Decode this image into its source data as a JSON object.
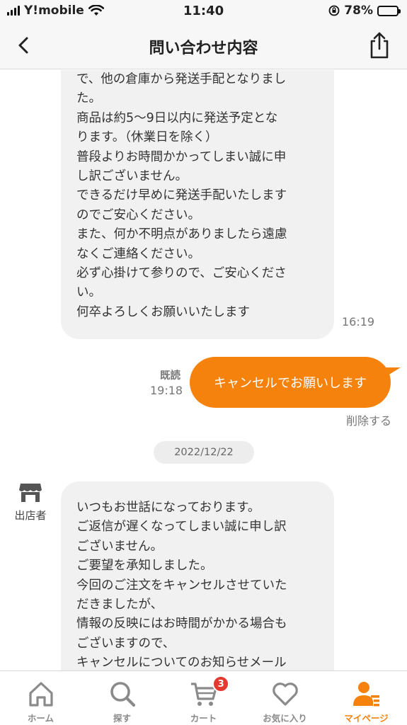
{
  "status_bar": {
    "carrier": "Y!mobile",
    "time": "11:40",
    "battery": "78%",
    "battery_level": 0.78
  },
  "header": {
    "title": "問い合わせ内容"
  },
  "messages": {
    "first": {
      "lines": [
        "で、他の倉庫から発送手配となりまし",
        "た。",
        "商品は約5〜9日以内に発送予定とな",
        "ります。（休業日を除く）",
        "普段よりお時間かかってしまい誠に申",
        "し訳ございません。",
        "できるだけ早めに発送手配いたします",
        "のでご安心ください。",
        "また、何か不明点がありましたら遠慮",
        "なくご連絡ください。",
        "必ず心掛けて参りので、ご安心くださ",
        "い。",
        "何卒よろしくお願いいたします"
      ],
      "time": "16:19"
    },
    "outgoing": {
      "text": "キャンセルでお願いします",
      "read_label": "既読",
      "time": "19:18",
      "delete_label": "削除する"
    },
    "date_separator": "2022/12/22",
    "seller_label": "出店者",
    "second": {
      "lines": [
        "いつもお世話になっております。",
        "ご返信が遅くなってしまい誠に申し訳",
        "ございません。",
        "ご要望を承知しました。",
        "今回のご注文をキャンセルさせていた",
        "だきましたが、",
        "情報の反映にはお時間がかかる場合も",
        "ございますので、",
        "キャンセルについてのお知らせメール"
      ]
    }
  },
  "tabbar": {
    "home": "ホーム",
    "search": "探す",
    "cart": "カート",
    "cart_badge": "3",
    "favorites": "お気に入り",
    "mypage": "マイページ"
  },
  "colors": {
    "accent": "#f5820c",
    "bubble_in": "#f1f1f1",
    "badge": "#e4392f"
  }
}
